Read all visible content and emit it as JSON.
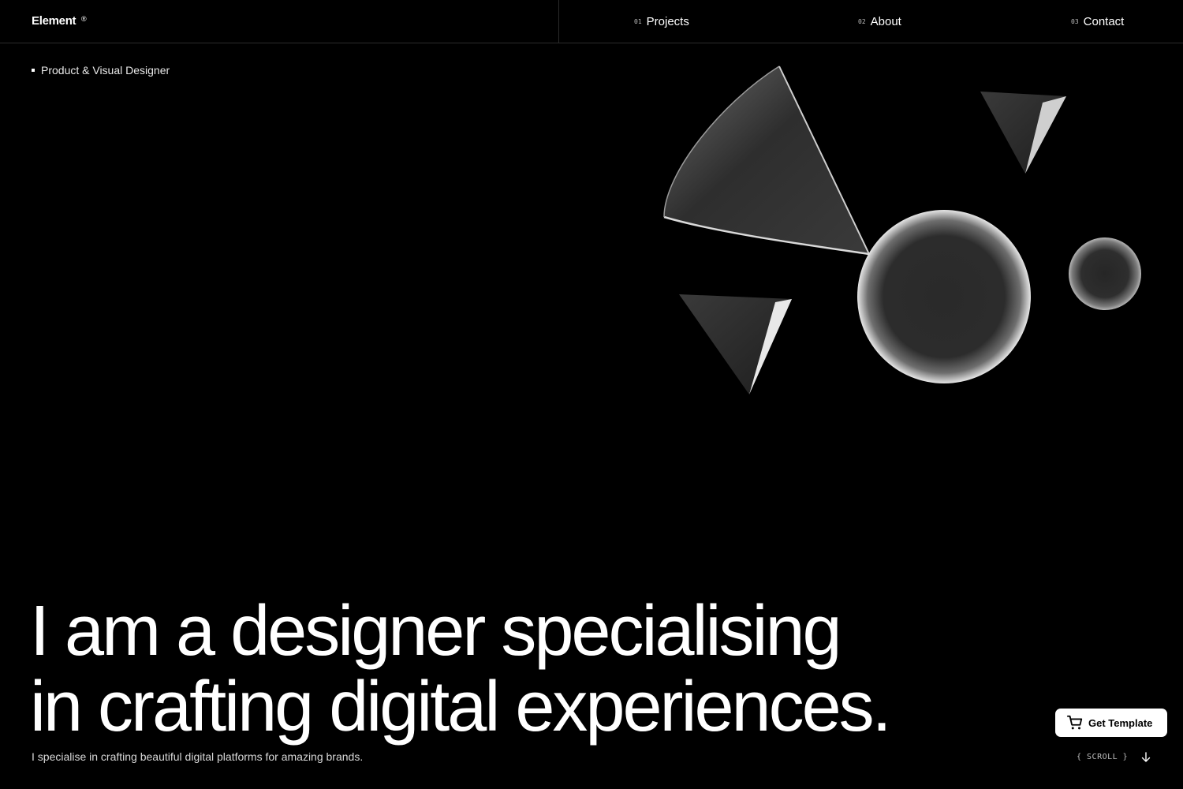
{
  "brand": {
    "name": "Element",
    "mark": "®"
  },
  "nav": [
    {
      "num": "01",
      "label": "Projects"
    },
    {
      "num": "02",
      "label": "About"
    },
    {
      "num": "03",
      "label": "Contact"
    }
  ],
  "hero": {
    "role": "Product & Visual Designer",
    "headline_line1": "I am a designer specialising",
    "headline_line2": "in crafting digital experiences.",
    "tagline": "I specialise in crafting beautiful digital platforms for amazing brands."
  },
  "cta": {
    "label": "Get Template",
    "icon": "cart-icon"
  },
  "scroll": {
    "label": "{ SCROLL }",
    "icon": "arrow-down-icon"
  },
  "colors": {
    "background": "#000000",
    "text": "#ffffff",
    "divider": "#2b2b2b"
  }
}
